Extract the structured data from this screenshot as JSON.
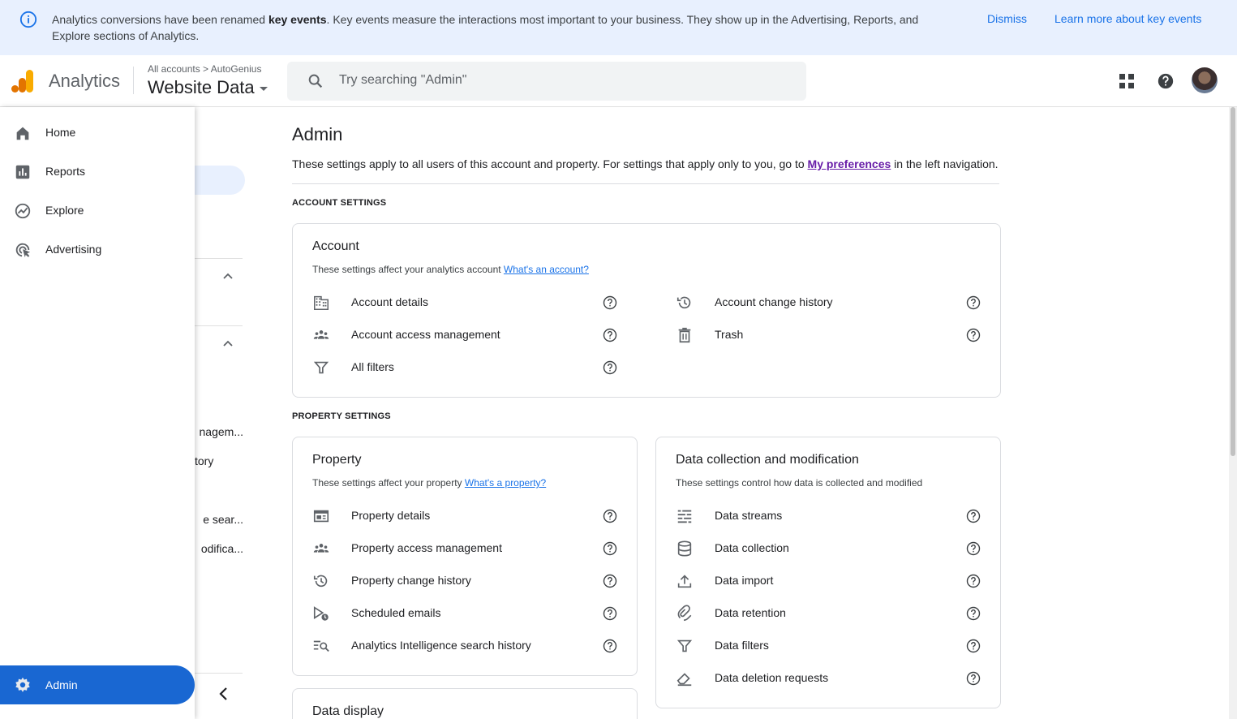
{
  "banner": {
    "text_start": "Analytics conversions have been renamed ",
    "text_bold": "key events",
    "text_end": ". Key events measure the interactions most important to your business. They show up in the Advertising, Reports, and Explore sections of Analytics.",
    "dismiss": "Dismiss",
    "learn_more": "Learn more about key events",
    "info_icon": "info-icon"
  },
  "header": {
    "app_name": "Analytics",
    "crumb_root": "All accounts",
    "crumb_sep": ">",
    "crumb_account": "AutoGenius",
    "property_name": "Website Data",
    "search_placeholder": "Try searching \"Admin\"",
    "icons": [
      "apps-grid-icon",
      "help-icon",
      "avatar"
    ]
  },
  "nav": {
    "items": [
      {
        "label": "Home",
        "icon": "home-icon"
      },
      {
        "label": "Reports",
        "icon": "reports-icon"
      },
      {
        "label": "Explore",
        "icon": "explore-icon"
      },
      {
        "label": "Advertising",
        "icon": "advertising-icon"
      }
    ],
    "admin": {
      "label": "Admin",
      "icon": "gear-icon"
    }
  },
  "subnav": {
    "truncated": [
      "nagem...",
      "tory",
      "e sear...",
      "odifica..."
    ]
  },
  "admin": {
    "title": "Admin",
    "desc_start": "These settings apply to all users of this account and property. For settings that apply only to you, go to ",
    "desc_link": "My preferences",
    "desc_end": " in the left navigation.",
    "account_section_label": "ACCOUNT SETTINGS",
    "property_section_label": "PROPERTY SETTINGS"
  },
  "account_card": {
    "title": "Account",
    "desc": "These settings affect your analytics account ",
    "desc_link": "What's an account?",
    "left_items": [
      {
        "label": "Account details",
        "icon": "building-icon"
      },
      {
        "label": "Account access management",
        "icon": "people-icon"
      },
      {
        "label": "All filters",
        "icon": "filter-icon"
      }
    ],
    "right_items": [
      {
        "label": "Account change history",
        "icon": "history-icon"
      },
      {
        "label": "Trash",
        "icon": "trash-icon"
      }
    ]
  },
  "property_card": {
    "title": "Property",
    "desc": "These settings affect your property ",
    "desc_link": "What's a property?",
    "items": [
      {
        "label": "Property details",
        "icon": "property-card-icon"
      },
      {
        "label": "Property access management",
        "icon": "people-icon"
      },
      {
        "label": "Property change history",
        "icon": "history-icon"
      },
      {
        "label": "Scheduled emails",
        "icon": "scheduled-email-icon"
      },
      {
        "label": "Analytics Intelligence search history",
        "icon": "search-list-icon"
      }
    ]
  },
  "data_card": {
    "title": "Data collection and modification",
    "desc": "These settings control how data is collected and modified",
    "items": [
      {
        "label": "Data streams",
        "icon": "streams-icon"
      },
      {
        "label": "Data collection",
        "icon": "database-icon"
      },
      {
        "label": "Data import",
        "icon": "upload-icon"
      },
      {
        "label": "Data retention",
        "icon": "retention-icon"
      },
      {
        "label": "Data filters",
        "icon": "filter-icon"
      },
      {
        "label": "Data deletion requests",
        "icon": "eraser-icon"
      }
    ]
  },
  "display_card": {
    "title": "Data display"
  },
  "colors": {
    "banner_bg": "#e8f0fe",
    "link_blue": "#1a73e8",
    "admin_blue": "#1967d2",
    "visited_link": "#681da8",
    "logo_orange": "#f9ab00",
    "logo_dark_orange": "#e37400"
  }
}
